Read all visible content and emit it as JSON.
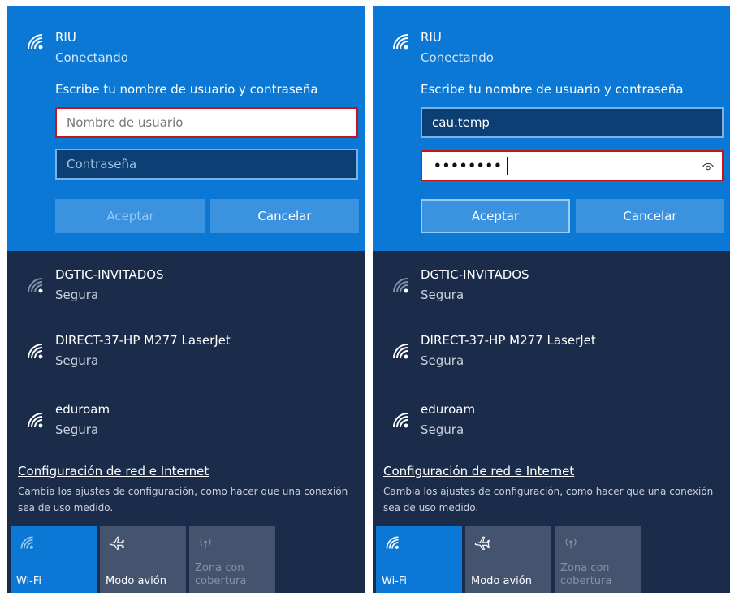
{
  "left_panel": {
    "connecting_network": {
      "ssid": "RIU",
      "status": "Conectando",
      "prompt": "Escribe tu nombre de usuario y contraseña",
      "username_placeholder": "Nombre de usuario",
      "username_value": "",
      "password_placeholder": "Contraseña",
      "password_value": "",
      "accept_label": "Aceptar",
      "cancel_label": "Cancelar"
    },
    "networks": [
      {
        "ssid": "DGTIC-INVITADOS",
        "security": "Segura"
      },
      {
        "ssid": "DIRECT-37-HP M277 LaserJet",
        "security": "Segura"
      },
      {
        "ssid": "eduroam",
        "security": "Segura"
      }
    ],
    "settings_link": "Configuración de red e Internet",
    "settings_desc": "Cambia los ajustes de configuración, como hacer que una conexión sea de uso medido.",
    "quick_actions": [
      {
        "label": "Wi-Fi",
        "icon": "wifi-icon"
      },
      {
        "label": "Modo avión",
        "icon": "airplane-icon"
      },
      {
        "label": "Zona con cobertura",
        "icon": "hotspot-icon"
      }
    ]
  },
  "right_panel": {
    "connecting_network": {
      "ssid": "RIU",
      "status": "Conectando",
      "prompt": "Escribe tu nombre de usuario y contraseña",
      "username_value": "cau.temp",
      "password_mask": "••••••••",
      "accept_label": "Aceptar",
      "cancel_label": "Cancelar"
    },
    "networks": [
      {
        "ssid": "DGTIC-INVITADOS",
        "security": "Segura"
      },
      {
        "ssid": "DIRECT-37-HP M277 LaserJet",
        "security": "Segura"
      },
      {
        "ssid": "eduroam",
        "security": "Segura"
      }
    ],
    "settings_link": "Configuración de red e Internet",
    "settings_desc": "Cambia los ajustes de configuración, como hacer que una conexión sea de uso medido.",
    "quick_actions": [
      {
        "label": "Wi-Fi",
        "icon": "wifi-icon"
      },
      {
        "label": "Modo avión",
        "icon": "airplane-icon"
      },
      {
        "label": "Zona con cobertura",
        "icon": "hotspot-icon"
      }
    ]
  },
  "colors": {
    "accent": "#0a78d4",
    "panel_bg": "#1b2c4a",
    "error_border": "#c5141c",
    "tile_inactive": "#44546e"
  }
}
